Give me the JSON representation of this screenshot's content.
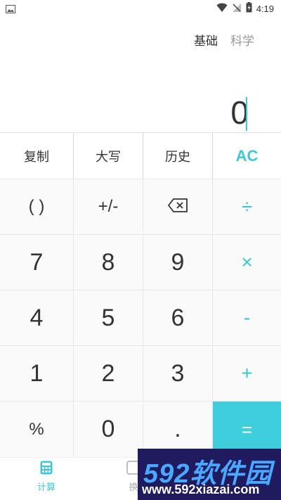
{
  "status_bar": {
    "time": "4:19",
    "icons": [
      "image-icon",
      "wifi-icon",
      "signal-icon",
      "battery-icon"
    ]
  },
  "modes": {
    "basic": "基础",
    "scientific": "科学",
    "active": "basic"
  },
  "display": {
    "value": "0"
  },
  "keypad": {
    "rows": [
      [
        "复制",
        "大写",
        "历史",
        "AC"
      ],
      [
        "( )",
        "+/-",
        "backspace",
        "÷"
      ],
      [
        "7",
        "8",
        "9",
        "×"
      ],
      [
        "4",
        "5",
        "6",
        "-"
      ],
      [
        "1",
        "2",
        "3",
        "+"
      ],
      [
        "%",
        "0",
        ".",
        "="
      ]
    ]
  },
  "bottom_nav": {
    "calc_label": "计算",
    "convert_label": "换"
  },
  "watermark": {
    "brand": "592软件园",
    "url": "www.592xiazai.com"
  },
  "colors": {
    "accent": "#3cc8d6",
    "equals_bg": "#3fcfdc",
    "text": "#333333",
    "muted": "#999999"
  }
}
